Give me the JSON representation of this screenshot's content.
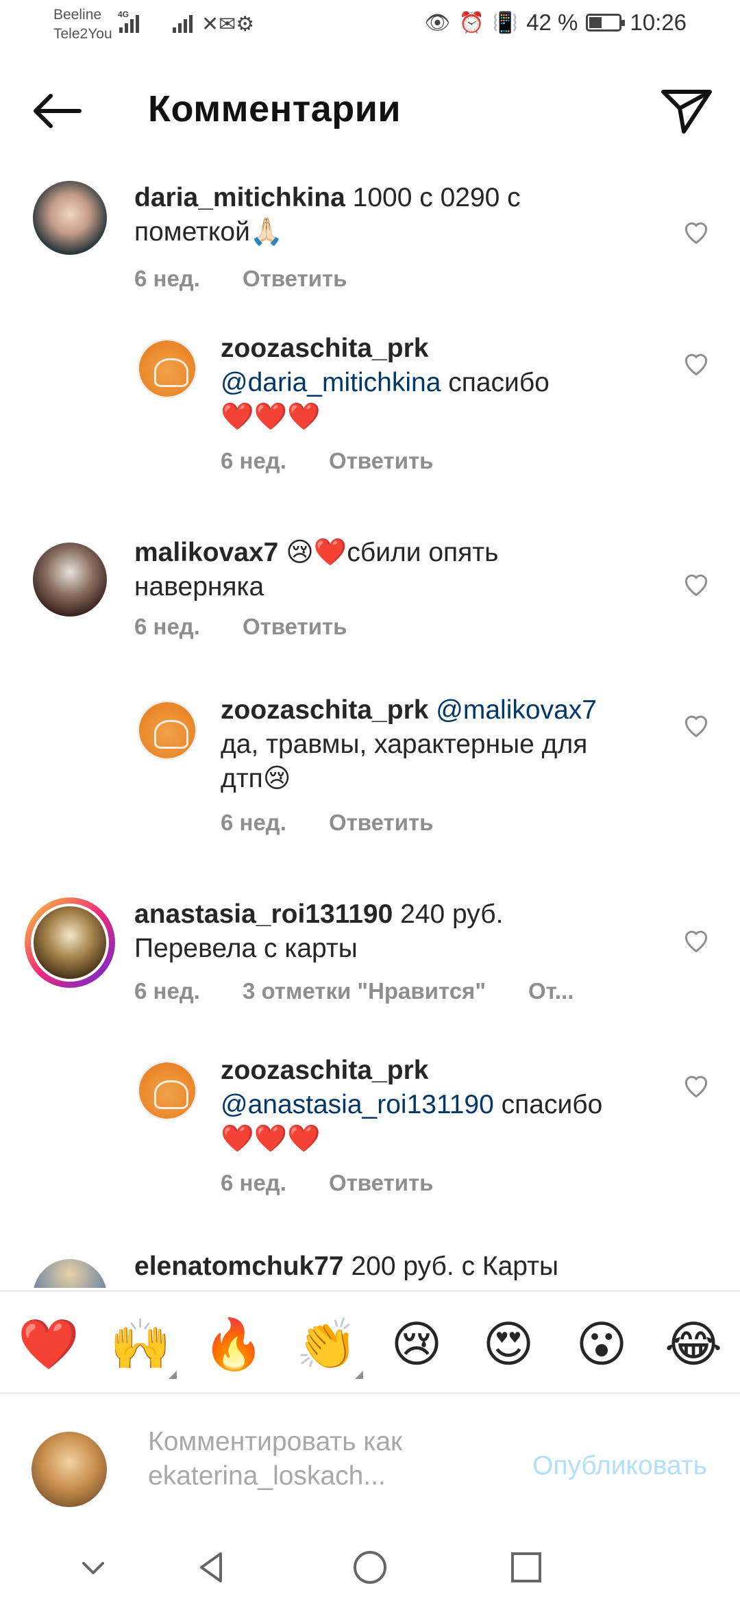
{
  "status": {
    "carrier1": "Beeline",
    "carrier2": "Tele2You",
    "net_type": "4G",
    "battery": "42 %",
    "battery_level": 0.42,
    "time": "10:26"
  },
  "header": {
    "title": "Комментарии"
  },
  "comments": [
    {
      "user": "daria_mitichkina",
      "mention": "",
      "text": " 1000 с 0290 с пометкой🙏🏻",
      "age": "6 нед.",
      "likes": "",
      "reply": "Ответить"
    },
    {
      "user": "zoozaschita_prk",
      "mention": "@daria_mitichkina",
      "text": " спасибо ❤️❤️❤️",
      "age": "6 нед.",
      "likes": "",
      "reply": "Ответить"
    },
    {
      "user": "malikovax7",
      "mention": "",
      "text": " 😢❤️сбили опять наверняка",
      "age": "6 нед.",
      "likes": "",
      "reply": "Ответить"
    },
    {
      "user": "zoozaschita_prk",
      "mention": "@malikovax7",
      "text": " да, травмы, характерные для дтп😢",
      "age": "6 нед.",
      "likes": "",
      "reply": "Ответить"
    },
    {
      "user": "anastasia_roi131190",
      "mention": "",
      "text": " 240 руб. Перевела с карты",
      "age": "6 нед.",
      "likes": "3 отметки \"Нравится\"",
      "reply": "От..."
    },
    {
      "user": "zoozaschita_prk",
      "mention": "@anastasia_roi131190",
      "text": " спасибо ❤️❤️❤️",
      "age": "6 нед.",
      "likes": "",
      "reply": "Ответить"
    },
    {
      "user": "elenatomchuk77",
      "mention": "",
      "text": " 200 руб. с Карты",
      "age": "",
      "likes": "",
      "reply": ""
    }
  ],
  "emoji_bar": [
    "❤️",
    "🙌",
    "🔥",
    "👏",
    "😢",
    "😍",
    "😮",
    "😂"
  ],
  "input": {
    "placeholder": "Комментировать как ekaterina_loskach...",
    "publish": "Опубликовать"
  },
  "colors": {
    "mention": "#00376b",
    "meta": "#8e8e8e",
    "publish_disabled": "#b2dffc"
  }
}
